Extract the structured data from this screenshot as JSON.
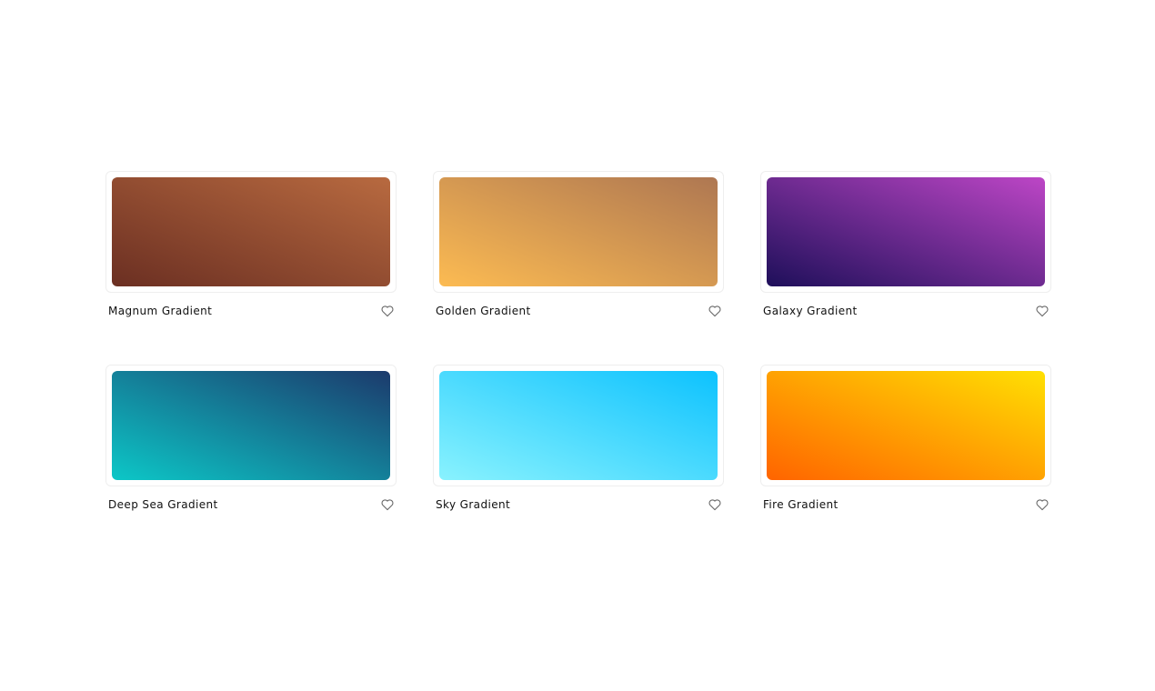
{
  "gradients": [
    {
      "name": "Magnum Gradient",
      "from": "#6b2f22",
      "to": "#b86a40",
      "favorite_icon": "heart-outline-icon"
    },
    {
      "name": "Golden Gradient",
      "from": "#fcbb52",
      "to": "#ae7752",
      "favorite_icon": "heart-outline-icon"
    },
    {
      "name": "Galaxy Gradient",
      "from": "#1e0f5a",
      "to": "#bd46c6",
      "favorite_icon": "heart-outline-icon"
    },
    {
      "name": "Deep Sea Gradient",
      "from": "#0cc7c7",
      "to": "#1c3a6c",
      "favorite_icon": "heart-outline-icon"
    },
    {
      "name": "Sky Gradient",
      "from": "#89f2fe",
      "to": "#0dc2fe",
      "favorite_icon": "heart-outline-icon"
    },
    {
      "name": "Fire Gradient",
      "from": "#ff6400",
      "to": "#ffe003",
      "favorite_icon": "heart-outline-icon"
    }
  ]
}
